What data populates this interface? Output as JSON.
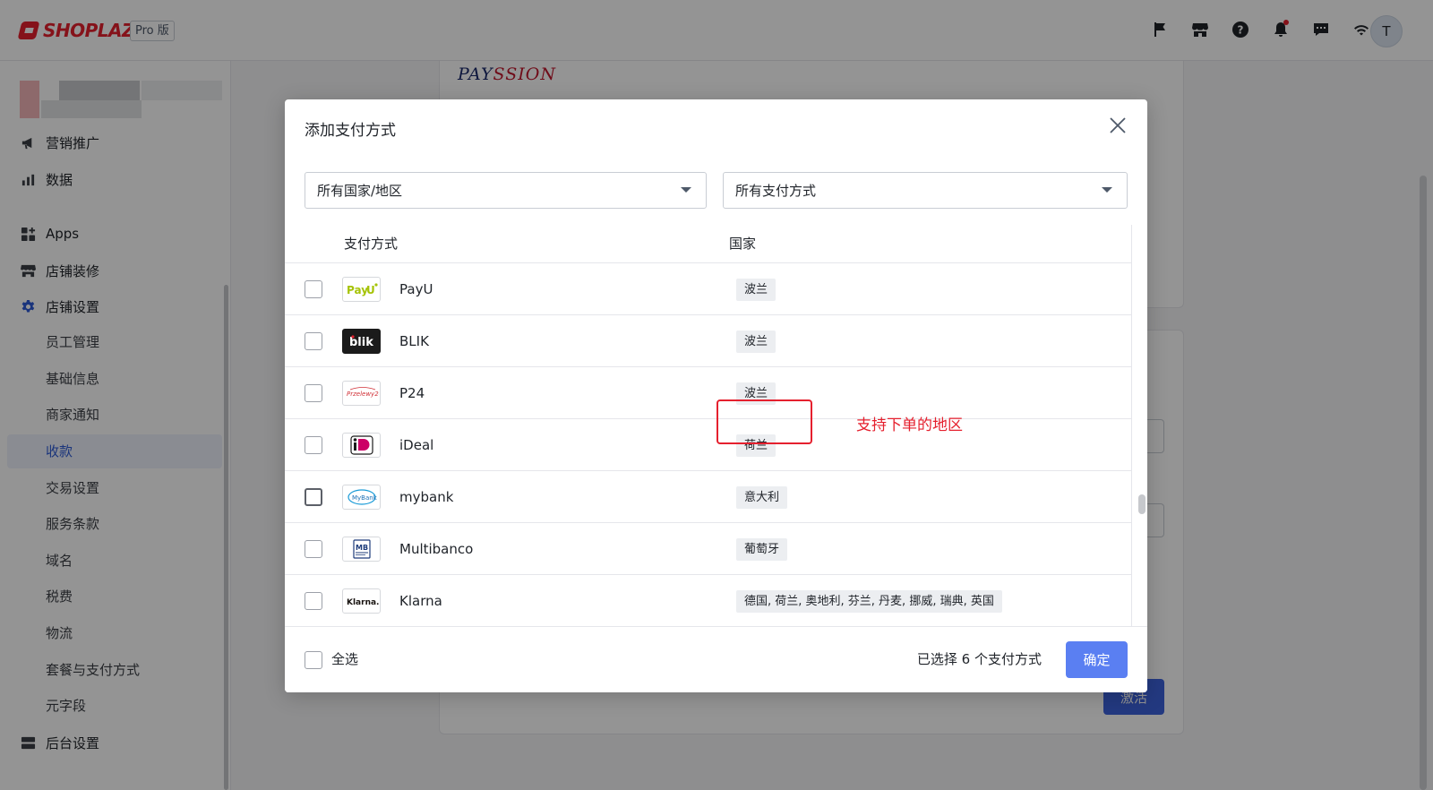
{
  "header": {
    "brand": "SHOPLAZZA",
    "plan_badge": "Pro 版",
    "avatar_initial": "T"
  },
  "sidebar": {
    "items": [
      {
        "label": "营销推广",
        "icon": "megaphone-icon"
      },
      {
        "label": "数据",
        "icon": "bar-chart-icon"
      },
      {
        "label": "Apps",
        "icon": "apps-icon"
      },
      {
        "label": "店铺装修",
        "icon": "storefront-icon"
      },
      {
        "label": "店铺设置",
        "icon": "gear-icon"
      }
    ],
    "sub_items": [
      "员工管理",
      "基础信息",
      "商家通知",
      "收款",
      "交易设置",
      "服务条款",
      "域名",
      "税费",
      "物流",
      "套餐与支付方式",
      "元字段"
    ],
    "active_sub": "收款",
    "bottom_item": {
      "label": "后台设置",
      "icon": "server-icon"
    }
  },
  "background": {
    "provider_logo": {
      "part1": "PAY",
      "part2": "SSION"
    },
    "activate_label": "激活"
  },
  "modal": {
    "title": "添加支付方式",
    "country_filter": "所有国家/地区",
    "method_filter": "所有支付方式",
    "columns": {
      "method": "支付方式",
      "country": "国家"
    },
    "rows": [
      {
        "name": "PayU",
        "logo": "payu-logo",
        "country": "波兰"
      },
      {
        "name": "BLIK",
        "logo": "blik-logo",
        "country": "波兰"
      },
      {
        "name": "P24",
        "logo": "przelewy24-logo",
        "country": "波兰"
      },
      {
        "name": "iDeal",
        "logo": "ideal-logo",
        "country": "荷兰"
      },
      {
        "name": "mybank",
        "logo": "mybank-logo",
        "country": "意大利"
      },
      {
        "name": "Multibanco",
        "logo": "multibanco-logo",
        "country": "葡萄牙"
      },
      {
        "name": "Klarna",
        "logo": "klarna-logo",
        "country": "德国, 荷兰, 奥地利, 芬兰, 丹麦, 挪威, 瑞典, 英国"
      }
    ],
    "annotation": "支持下单的地区",
    "select_all": "全选",
    "selected_count": "已选择 6 个支付方式",
    "confirm": "确定"
  },
  "colors": {
    "brand_red": "#e5202e",
    "primary_blue": "#5a7ff2",
    "active_nav": "#2e5bd6"
  }
}
